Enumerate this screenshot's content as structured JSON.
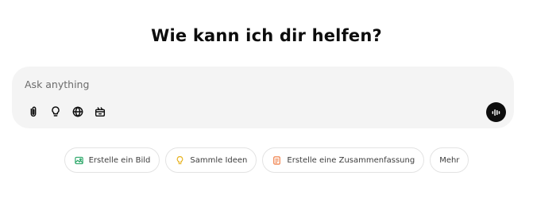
{
  "heading": "Wie kann ich dir helfen?",
  "composer": {
    "placeholder": "Ask anything",
    "tools": [
      {
        "icon": "paperclip-icon"
      },
      {
        "icon": "lightbulb-icon"
      },
      {
        "icon": "globe-icon"
      },
      {
        "icon": "canvas-icon"
      }
    ],
    "voice_icon": "voice-mode-icon"
  },
  "suggestions": [
    {
      "label": "Erstelle ein Bild",
      "icon": "image-icon",
      "color": "#2ea86a"
    },
    {
      "label": "Sammle Ideen",
      "icon": "lightbulb-icon",
      "color": "#e8b320"
    },
    {
      "label": "Erstelle eine Zusammenfassung",
      "icon": "document-icon",
      "color": "#f0804a"
    },
    {
      "label": "Mehr"
    }
  ]
}
